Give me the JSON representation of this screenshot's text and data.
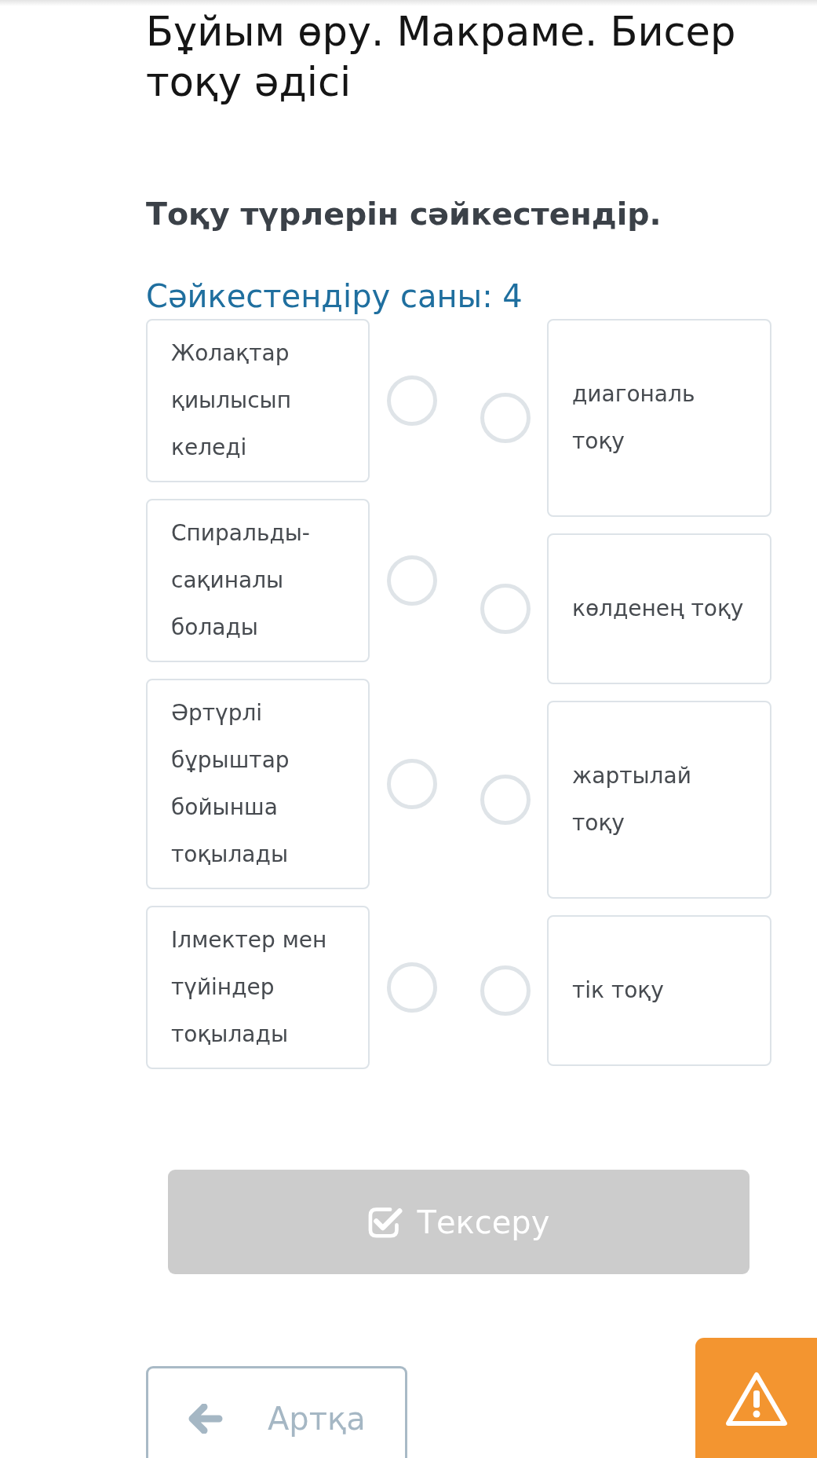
{
  "page": {
    "title": "Бұйым өру. Макраме. Бисер тоқу әдісі"
  },
  "task": {
    "instruction": "Тоқу түрлерін сәйкестендір.",
    "match_count": "Сәйкестендіру саны: 4"
  },
  "left_items": [
    {
      "text": "Жолақтар қиылысып келеді"
    },
    {
      "text": "Спиральды-сақиналы болады"
    },
    {
      "text": "Әртүрлі бұрыштар бойынша тоқылады"
    },
    {
      "text": "Ілмектер мен түйіндер тоқылады"
    }
  ],
  "right_items": [
    {
      "text": "диагональ тоқу"
    },
    {
      "text": "көлденең тоқу"
    },
    {
      "text": "жартылай тоқу"
    },
    {
      "text": "тік тоқу"
    }
  ],
  "check_button": {
    "label": "Тексеру",
    "disabled": true
  },
  "back_button": {
    "label": "Артқа"
  }
}
